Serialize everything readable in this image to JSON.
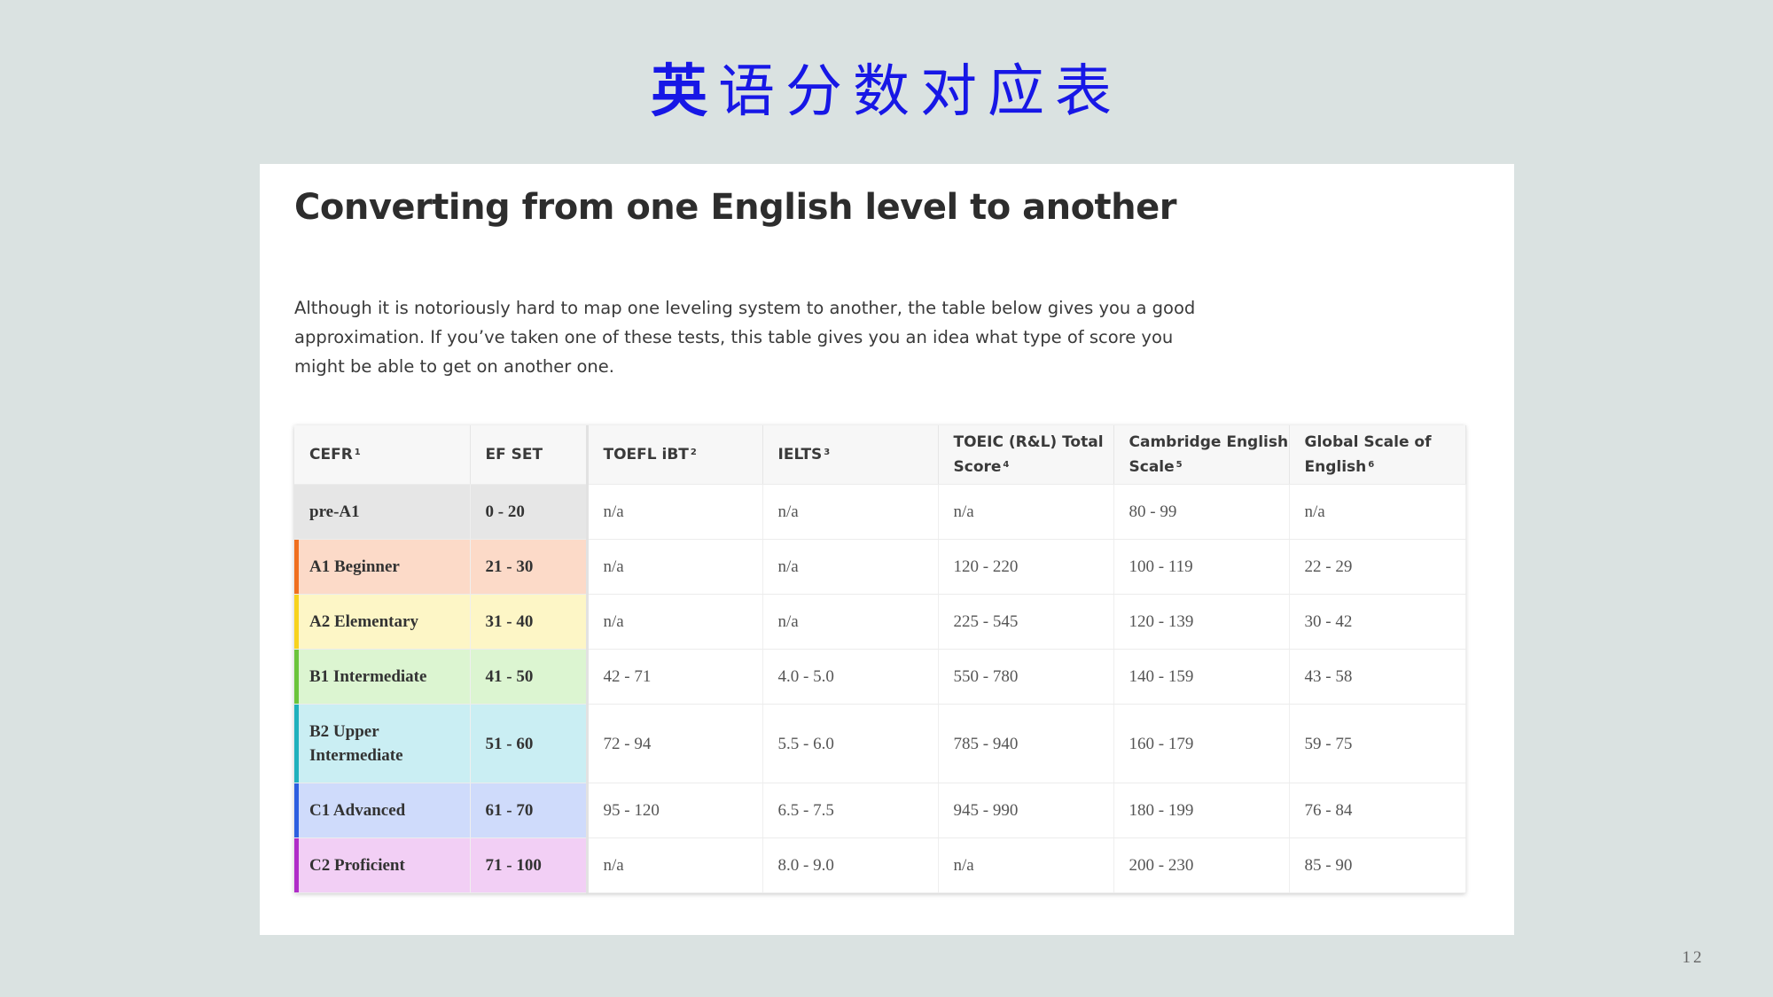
{
  "slide": {
    "title_first": "英",
    "title_rest": "语分数对应表",
    "page_number": "12"
  },
  "card": {
    "heading": "Converting from one English level to another",
    "intro": "Although it is notoriously hard to map one leveling system to another, the table below gives you a good approximation. If you’ve taken one of these tests, this table gives you an idea what type of score you might be able to get on another one."
  },
  "table": {
    "headers": [
      {
        "label": "CEFR",
        "note": "1"
      },
      {
        "label": "EF SET",
        "note": ""
      },
      {
        "label": "TOEFL iBT",
        "note": "2"
      },
      {
        "label": "IELTS",
        "note": "3"
      },
      {
        "label": "TOEIC (R&L) Total Score",
        "note": "4"
      },
      {
        "label": "Cambridge English Scale",
        "note": "5"
      },
      {
        "label": "Global Scale of English",
        "note": "6"
      }
    ],
    "rows": [
      {
        "level": "pre-A1",
        "ef_set": "0 - 20",
        "toefl": "n/a",
        "ielts": "n/a",
        "toeic": "n/a",
        "cambridge": "80 - 99",
        "gse": "n/a",
        "bg": "#e6e6e6",
        "stripe": "#e6e6e6"
      },
      {
        "level": "A1 Beginner",
        "ef_set": "21 - 30",
        "toefl": "n/a",
        "ielts": "n/a",
        "toeic": "120 - 220",
        "cambridge": "100 - 119",
        "gse": "22 - 29",
        "bg": "#fcdac8",
        "stripe": "#f07020"
      },
      {
        "level": "A2 Elementary",
        "ef_set": "31 - 40",
        "toefl": "n/a",
        "ielts": "n/a",
        "toeic": "225 - 545",
        "cambridge": "120 - 139",
        "gse": "30 - 42",
        "bg": "#fdf6c6",
        "stripe": "#f7d31e"
      },
      {
        "level": "B1 Intermediate",
        "ef_set": "41 - 50",
        "toefl": "42 - 71",
        "ielts": "4.0 - 5.0",
        "toeic": "550 - 780",
        "cambridge": "140 - 159",
        "gse": "43 - 58",
        "bg": "#dcf5d1",
        "stripe": "#6cc43c"
      },
      {
        "level": "B2 Upper Intermediate",
        "ef_set": "51 - 60",
        "toefl": "72 - 94",
        "ielts": "5.5 - 6.0",
        "toeic": "785 - 940",
        "cambridge": "160 - 179",
        "gse": "59 - 75",
        "bg": "#caeef3",
        "stripe": "#20b1bd"
      },
      {
        "level": "C1 Advanced",
        "ef_set": "61 - 70",
        "toefl": "95 - 120",
        "ielts": "6.5 - 7.5",
        "toeic": "945 - 990",
        "cambridge": "180 - 199",
        "gse": "76 - 84",
        "bg": "#cfdbfb",
        "stripe": "#2d5fe0"
      },
      {
        "level": "C2 Proficient",
        "ef_set": "71 - 100",
        "toefl": "n/a",
        "ielts": "8.0 - 9.0",
        "toeic": "n/a",
        "cambridge": "200 - 230",
        "gse": "85 - 90",
        "bg": "#f2cff5",
        "stripe": "#b02dc8"
      }
    ]
  }
}
